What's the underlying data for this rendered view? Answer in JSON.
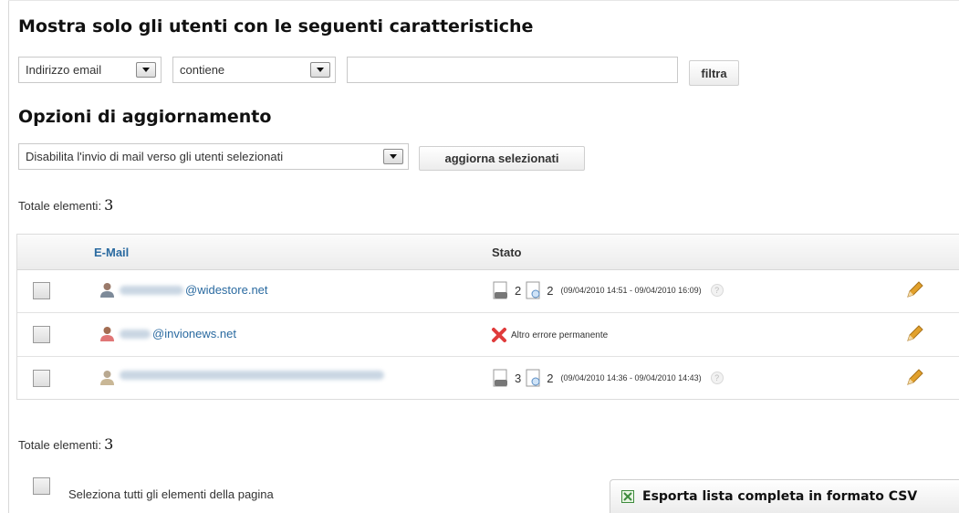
{
  "filter": {
    "title": "Mostra solo gli utenti con le seguenti caratteristiche",
    "field": "Indirizzo email",
    "operator": "contiene",
    "value": "",
    "button": "filtra"
  },
  "update": {
    "title": "Opzioni di aggiornamento",
    "action": "Disabilita l'invio di mail verso gli utenti selezionati",
    "button": "aggiorna selezionati"
  },
  "totals": {
    "label": "Totale elementi:",
    "count": "3"
  },
  "table": {
    "columns": {
      "email": "E-Mail",
      "status": "Stato"
    },
    "rows": [
      {
        "email_domain": "@widestore.net",
        "sent": "2",
        "opened": "2",
        "dates": "(09/04/2010 14:51 - 09/04/2010 16:09)",
        "error": ""
      },
      {
        "email_domain": "@invionews.net",
        "sent": "",
        "opened": "",
        "dates": "",
        "error": "Altro errore permanente"
      },
      {
        "email_domain": "",
        "sent": "3",
        "opened": "2",
        "dates": "(09/04/2010 14:36 - 09/04/2010 14:43)",
        "error": ""
      }
    ]
  },
  "footer": {
    "select_all": "Seleziona tutti gli elementi della pagina",
    "export": "Esporta lista completa in formato CSV"
  },
  "help_mark": "?",
  "colors": {
    "link": "#2a6aa0",
    "error": "#e03b3b",
    "pencil": "#e2a12c"
  }
}
